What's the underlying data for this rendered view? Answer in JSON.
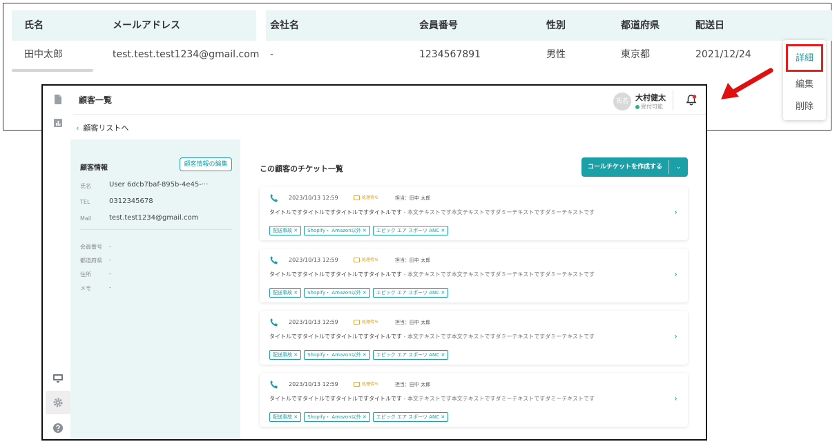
{
  "table": {
    "headers": [
      "氏名",
      "メールアドレス",
      "会社名",
      "会員番号",
      "性別",
      "都道府県",
      "配送日"
    ],
    "row": [
      "田中太郎",
      "test.test.test1234@gmail.com",
      "-",
      "1234567891",
      "男性",
      "東京都",
      "2021/12/24"
    ]
  },
  "context_menu": {
    "detail": "詳細",
    "edit": "編集",
    "delete": "削除"
  },
  "app": {
    "page_title": "顧客一覧",
    "back_link": "顧客リストへ",
    "user": {
      "avatar_text": "氏名",
      "name": "大村健太",
      "status": "受付可能"
    }
  },
  "customer_info": {
    "title": "顧客情報",
    "edit_button": "顧客情報の編集",
    "fields": [
      {
        "label": "氏名",
        "value": "User 6dcb7baf-895b-4e45-···"
      },
      {
        "label": "TEL",
        "value": "0312345678"
      },
      {
        "label": "Mail",
        "value": "test.test1234@gmail.com"
      }
    ],
    "meta": [
      {
        "label": "会員番号",
        "value": "-"
      },
      {
        "label": "都道府県",
        "value": "-"
      },
      {
        "label": "住所",
        "value": "-"
      },
      {
        "label": "メモ",
        "value": "-"
      }
    ]
  },
  "tickets": {
    "title": "この顧客のチケット一覧",
    "create_button": "コールチケットを作成する",
    "items": [
      {
        "datetime": "2023/10/13 12:59",
        "status": "処理待ち",
        "assignee": "担当：田中 太郎",
        "title": "タイトルですタイトルですタイトルですタイトルです",
        "body": " - 本文テキストです本文テキストですダミーテキストですダミーテキストです",
        "tags": [
          "配送事故 ✕",
          "Shopify・ Amazon以外 ✕",
          "エピック エア スポーツ ANC ✕"
        ]
      },
      {
        "datetime": "2023/10/13 12:59",
        "status": "処理待ち",
        "assignee": "担当：田中 太郎",
        "title": "タイトルですタイトルですタイトルですタイトルです",
        "body": " - 本文テキストです本文テキストですダミーテキストですダミーテキストです",
        "tags": [
          "配送事故 ✕",
          "Shopify・ Amazon以外 ✕",
          "エピック エア スポーツ ANC ✕"
        ]
      },
      {
        "datetime": "2023/10/13 12:59",
        "status": "処理待ち",
        "assignee": "担当：田中 太郎",
        "title": "タイトルですタイトルですタイトルですタイトルです",
        "body": " - 本文テキストです本文テキストですダミーテキストですダミーテキストです",
        "tags": [
          "配送事故 ✕",
          "Shopify・ Amazon以外 ✕",
          "エピック エア スポーツ ANC ✕"
        ]
      },
      {
        "datetime": "2023/10/13 12:59",
        "status": "処理待ち",
        "assignee": "担当：田中 太郎",
        "title": "タイトルですタイトルですタイトルですタイトルです",
        "body": " - 本文テキストです本文テキストですダミーテキストですダミーテキストです",
        "tags": [
          "配送事故 ✕",
          "Shopify・ Amazon以外 ✕",
          "エピック エア スポーツ ANC ✕"
        ]
      }
    ]
  },
  "icons": {
    "rail": [
      "document-icon",
      "chart-icon",
      "monitor-icon",
      "gear-icon",
      "help-icon"
    ],
    "topbar": [
      "bell-icon"
    ],
    "ticket": [
      "phone-icon",
      "chevron-right-icon"
    ]
  },
  "colors": {
    "accent": "#1ba0a8",
    "highlight_border": "#e02020",
    "arrow": "#e01010",
    "status_pending": "#f0a800",
    "panel_bg": "#eaf6f6",
    "online": "#2bb673",
    "notification": "#e03030"
  }
}
